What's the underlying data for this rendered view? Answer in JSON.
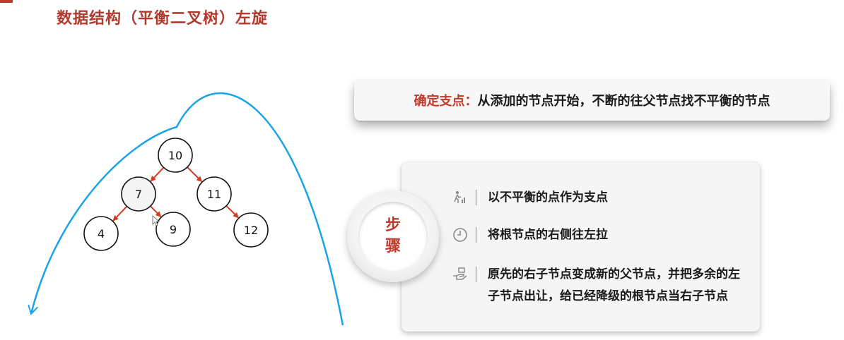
{
  "title": "数据结构（平衡二叉树）左旋",
  "callout": {
    "label": "确定支点：",
    "text": "从添加的节点开始，不断的往父节点找不平衡的节点"
  },
  "steps": {
    "badge": "步骤",
    "items": [
      {
        "icon": "walking-person-chart-icon",
        "text": "以不平衡的点作为支点"
      },
      {
        "icon": "clock-icon",
        "text": "将根节点的右侧往左拉"
      },
      {
        "icon": "hand-offering-icon",
        "text": "原先的右子节点变成新的父节点，并把多余的左子节点出让，给已经降级的根节点当右子节点"
      }
    ]
  },
  "tree": {
    "nodes": [
      {
        "id": "n10",
        "label": "10"
      },
      {
        "id": "n7",
        "label": "7"
      },
      {
        "id": "n11",
        "label": "11"
      },
      {
        "id": "n4",
        "label": "4"
      },
      {
        "id": "n9",
        "label": "9"
      },
      {
        "id": "n12",
        "label": "12"
      }
    ],
    "edges": [
      [
        "n10",
        "n7"
      ],
      [
        "n10",
        "n11"
      ],
      [
        "n7",
        "n4"
      ],
      [
        "n7",
        "n9"
      ],
      [
        "n11",
        "n12"
      ]
    ]
  },
  "colors": {
    "title": "#b03a2e",
    "accent": "#c0392b",
    "edge": "#d63a1e",
    "rotation_arc": "#1aa3e8"
  }
}
